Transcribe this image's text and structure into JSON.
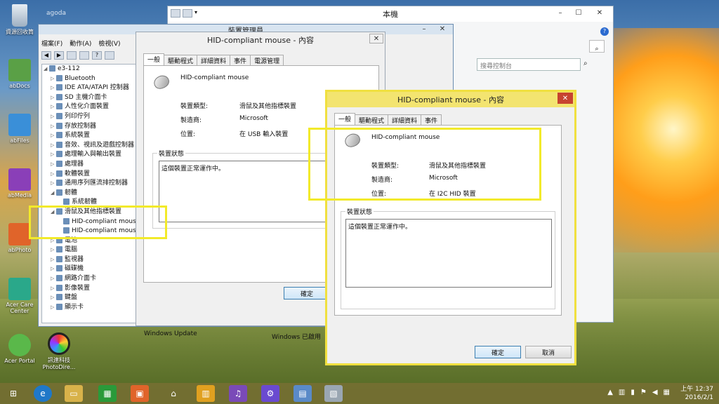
{
  "desktop": {
    "icons": [
      {
        "label": "資源回收筒",
        "icon": "recycle-bin-icon"
      },
      {
        "label": "abDocs",
        "icon": "docs-icon"
      },
      {
        "label": "abFiles",
        "icon": "files-icon"
      },
      {
        "label": "abMedia",
        "icon": "media-icon"
      },
      {
        "label": "abPhoto",
        "icon": "photo-icon"
      },
      {
        "label": "Acer Care Center",
        "icon": "care-center-icon"
      },
      {
        "label": "Acer Portal",
        "icon": "portal-icon"
      },
      {
        "label": "訊連科技 PhotoDire...",
        "icon": "photodirector-icon"
      }
    ],
    "watermark": "agoda"
  },
  "explorer": {
    "title": "本機",
    "search_placeholder": "搜尋控制台",
    "update_label": "Windows Update",
    "update_status": "Windows 已啟用"
  },
  "devmgr": {
    "title": "裝置管理員",
    "menu": [
      "檔案(F)",
      "動作(A)",
      "檢視(V)"
    ],
    "tree": [
      {
        "label": "e3-112",
        "arrow": "◢",
        "indent": 0
      },
      {
        "label": "Bluetooth",
        "arrow": "▷",
        "indent": 1
      },
      {
        "label": "IDE ATA/ATAPI 控制器",
        "arrow": "▷",
        "indent": 1
      },
      {
        "label": "SD 主機介面卡",
        "arrow": "▷",
        "indent": 1
      },
      {
        "label": "人性化介面裝置",
        "arrow": "▷",
        "indent": 1
      },
      {
        "label": "列印佇列",
        "arrow": "▷",
        "indent": 1
      },
      {
        "label": "存放控制器",
        "arrow": "▷",
        "indent": 1
      },
      {
        "label": "系統裝置",
        "arrow": "▷",
        "indent": 1
      },
      {
        "label": "音效、視訊及遊戲控制器",
        "arrow": "▷",
        "indent": 1
      },
      {
        "label": "處理輸入與輸出裝置",
        "arrow": "▷",
        "indent": 1
      },
      {
        "label": "處理器",
        "arrow": "▷",
        "indent": 1
      },
      {
        "label": "軟體裝置",
        "arrow": "▷",
        "indent": 1
      },
      {
        "label": "通用序列匯流排控制器",
        "arrow": "▷",
        "indent": 1
      },
      {
        "label": "韌體",
        "arrow": "◢",
        "indent": 1
      },
      {
        "label": "系統韌體",
        "arrow": "",
        "indent": 2
      },
      {
        "label": "滑鼠及其他指標裝置",
        "arrow": "◢",
        "indent": 1
      },
      {
        "label": "HID-compliant mouse",
        "arrow": "",
        "indent": 2
      },
      {
        "label": "HID-compliant mouse",
        "arrow": "",
        "indent": 2
      },
      {
        "label": "電池",
        "arrow": "▷",
        "indent": 1
      },
      {
        "label": "電腦",
        "arrow": "▷",
        "indent": 1
      },
      {
        "label": "監視器",
        "arrow": "▷",
        "indent": 1
      },
      {
        "label": "磁碟機",
        "arrow": "▷",
        "indent": 1
      },
      {
        "label": "網路介面卡",
        "arrow": "▷",
        "indent": 1
      },
      {
        "label": "影像裝置",
        "arrow": "▷",
        "indent": 1
      },
      {
        "label": "鍵盤",
        "arrow": "▷",
        "indent": 1
      },
      {
        "label": "顯示卡",
        "arrow": "▷",
        "indent": 1
      }
    ]
  },
  "dlg1": {
    "title": "HID-compliant mouse - 內容",
    "tabs": [
      "一般",
      "驅動程式",
      "詳細資料",
      "事件",
      "電源管理"
    ],
    "device_name": "HID-compliant mouse",
    "type_label": "裝置類型:",
    "type_value": "滑鼠及其他指標裝置",
    "mfr_label": "製造商:",
    "mfr_value": "Microsoft",
    "loc_label": "位置:",
    "loc_value": "在 USB 輸入裝置",
    "status_group": "裝置狀態",
    "status_text": "這個裝置正常運作中。",
    "ok": "確定"
  },
  "dlg2": {
    "title": "HID-compliant mouse - 內容",
    "tabs": [
      "一般",
      "驅動程式",
      "詳細資料",
      "事件"
    ],
    "device_name": "HID-compliant mouse",
    "type_label": "裝置類型:",
    "type_value": "滑鼠及其他指標裝置",
    "mfr_label": "製造商:",
    "mfr_value": "Microsoft",
    "loc_label": "位置:",
    "loc_value": "在 I2C HID 裝置",
    "status_group": "裝置狀態",
    "status_text": "這個裝置正常運作中。",
    "ok": "確定",
    "cancel": "取消"
  },
  "taskbar": {
    "clock_time": "上午 12:37",
    "clock_date": "2016/2/1"
  }
}
